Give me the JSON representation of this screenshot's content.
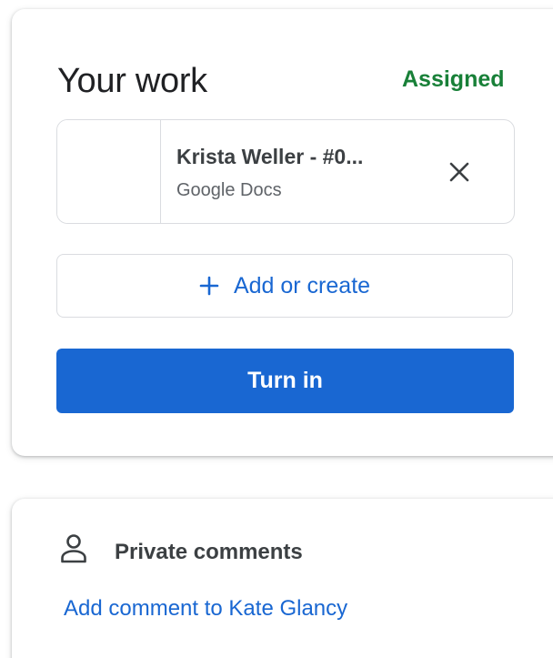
{
  "work": {
    "title": "Your work",
    "status": "Assigned",
    "attachment": {
      "title": "Krista Weller - #0...",
      "type": "Google Docs"
    },
    "add_label": "Add or create",
    "turn_in_label": "Turn in"
  },
  "comments": {
    "title": "Private comments",
    "add_link": "Add comment to Kate Glancy"
  },
  "colors": {
    "accent": "#1967d2",
    "status_green": "#188038",
    "text_primary": "#202124",
    "text_secondary": "#5f6368",
    "border": "#dadce0"
  },
  "icons": {
    "remove": "close-icon",
    "add": "plus-icon",
    "comments": "person-icon"
  }
}
